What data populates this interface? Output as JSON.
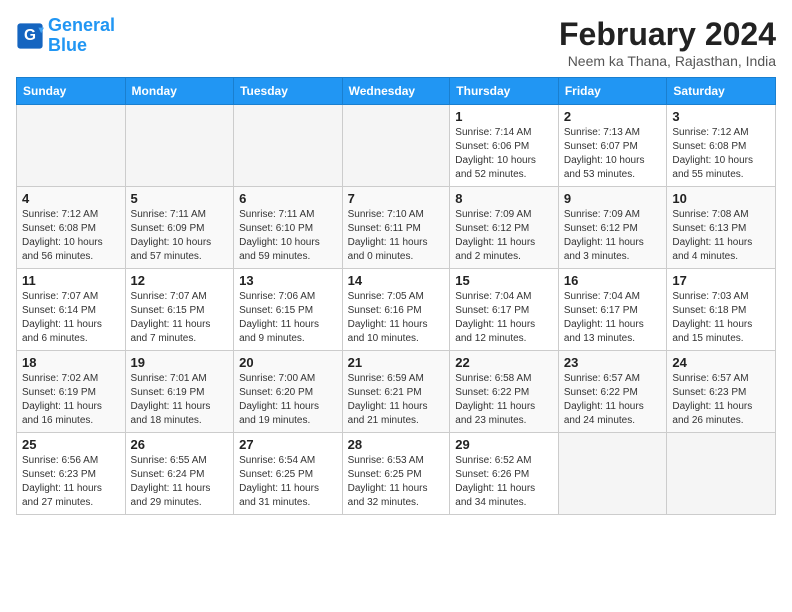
{
  "logo": {
    "line1": "General",
    "line2": "Blue"
  },
  "title": "February 2024",
  "subtitle": "Neem ka Thana, Rajasthan, India",
  "days_of_week": [
    "Sunday",
    "Monday",
    "Tuesday",
    "Wednesday",
    "Thursday",
    "Friday",
    "Saturday"
  ],
  "weeks": [
    [
      {
        "day": "",
        "info": ""
      },
      {
        "day": "",
        "info": ""
      },
      {
        "day": "",
        "info": ""
      },
      {
        "day": "",
        "info": ""
      },
      {
        "day": "1",
        "info": "Sunrise: 7:14 AM\nSunset: 6:06 PM\nDaylight: 10 hours\nand 52 minutes."
      },
      {
        "day": "2",
        "info": "Sunrise: 7:13 AM\nSunset: 6:07 PM\nDaylight: 10 hours\nand 53 minutes."
      },
      {
        "day": "3",
        "info": "Sunrise: 7:12 AM\nSunset: 6:08 PM\nDaylight: 10 hours\nand 55 minutes."
      }
    ],
    [
      {
        "day": "4",
        "info": "Sunrise: 7:12 AM\nSunset: 6:08 PM\nDaylight: 10 hours\nand 56 minutes."
      },
      {
        "day": "5",
        "info": "Sunrise: 7:11 AM\nSunset: 6:09 PM\nDaylight: 10 hours\nand 57 minutes."
      },
      {
        "day": "6",
        "info": "Sunrise: 7:11 AM\nSunset: 6:10 PM\nDaylight: 10 hours\nand 59 minutes."
      },
      {
        "day": "7",
        "info": "Sunrise: 7:10 AM\nSunset: 6:11 PM\nDaylight: 11 hours\nand 0 minutes."
      },
      {
        "day": "8",
        "info": "Sunrise: 7:09 AM\nSunset: 6:12 PM\nDaylight: 11 hours\nand 2 minutes."
      },
      {
        "day": "9",
        "info": "Sunrise: 7:09 AM\nSunset: 6:12 PM\nDaylight: 11 hours\nand 3 minutes."
      },
      {
        "day": "10",
        "info": "Sunrise: 7:08 AM\nSunset: 6:13 PM\nDaylight: 11 hours\nand 4 minutes."
      }
    ],
    [
      {
        "day": "11",
        "info": "Sunrise: 7:07 AM\nSunset: 6:14 PM\nDaylight: 11 hours\nand 6 minutes."
      },
      {
        "day": "12",
        "info": "Sunrise: 7:07 AM\nSunset: 6:15 PM\nDaylight: 11 hours\nand 7 minutes."
      },
      {
        "day": "13",
        "info": "Sunrise: 7:06 AM\nSunset: 6:15 PM\nDaylight: 11 hours\nand 9 minutes."
      },
      {
        "day": "14",
        "info": "Sunrise: 7:05 AM\nSunset: 6:16 PM\nDaylight: 11 hours\nand 10 minutes."
      },
      {
        "day": "15",
        "info": "Sunrise: 7:04 AM\nSunset: 6:17 PM\nDaylight: 11 hours\nand 12 minutes."
      },
      {
        "day": "16",
        "info": "Sunrise: 7:04 AM\nSunset: 6:17 PM\nDaylight: 11 hours\nand 13 minutes."
      },
      {
        "day": "17",
        "info": "Sunrise: 7:03 AM\nSunset: 6:18 PM\nDaylight: 11 hours\nand 15 minutes."
      }
    ],
    [
      {
        "day": "18",
        "info": "Sunrise: 7:02 AM\nSunset: 6:19 PM\nDaylight: 11 hours\nand 16 minutes."
      },
      {
        "day": "19",
        "info": "Sunrise: 7:01 AM\nSunset: 6:19 PM\nDaylight: 11 hours\nand 18 minutes."
      },
      {
        "day": "20",
        "info": "Sunrise: 7:00 AM\nSunset: 6:20 PM\nDaylight: 11 hours\nand 19 minutes."
      },
      {
        "day": "21",
        "info": "Sunrise: 6:59 AM\nSunset: 6:21 PM\nDaylight: 11 hours\nand 21 minutes."
      },
      {
        "day": "22",
        "info": "Sunrise: 6:58 AM\nSunset: 6:22 PM\nDaylight: 11 hours\nand 23 minutes."
      },
      {
        "day": "23",
        "info": "Sunrise: 6:57 AM\nSunset: 6:22 PM\nDaylight: 11 hours\nand 24 minutes."
      },
      {
        "day": "24",
        "info": "Sunrise: 6:57 AM\nSunset: 6:23 PM\nDaylight: 11 hours\nand 26 minutes."
      }
    ],
    [
      {
        "day": "25",
        "info": "Sunrise: 6:56 AM\nSunset: 6:23 PM\nDaylight: 11 hours\nand 27 minutes."
      },
      {
        "day": "26",
        "info": "Sunrise: 6:55 AM\nSunset: 6:24 PM\nDaylight: 11 hours\nand 29 minutes."
      },
      {
        "day": "27",
        "info": "Sunrise: 6:54 AM\nSunset: 6:25 PM\nDaylight: 11 hours\nand 31 minutes."
      },
      {
        "day": "28",
        "info": "Sunrise: 6:53 AM\nSunset: 6:25 PM\nDaylight: 11 hours\nand 32 minutes."
      },
      {
        "day": "29",
        "info": "Sunrise: 6:52 AM\nSunset: 6:26 PM\nDaylight: 11 hours\nand 34 minutes."
      },
      {
        "day": "",
        "info": ""
      },
      {
        "day": "",
        "info": ""
      }
    ]
  ]
}
